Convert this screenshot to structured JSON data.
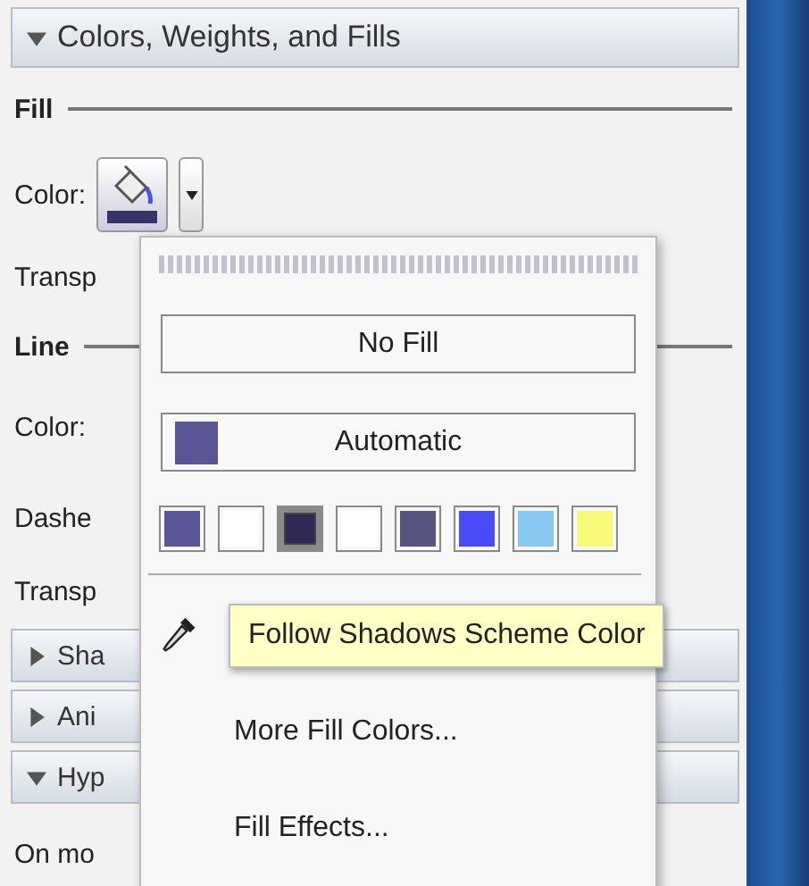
{
  "section_header": {
    "title": "Colors, Weights, and Fills",
    "expanded": true
  },
  "fill_group": {
    "title": "Fill",
    "color_label": "Color:",
    "transparency_label": "Transp"
  },
  "line_group": {
    "title": "Line",
    "color_label": "Color:",
    "dashed_label": "Dashe",
    "transparency_label": "Transp"
  },
  "collapsed_sections": [
    {
      "title": "Sha",
      "expanded": false
    },
    {
      "title": "Ani",
      "expanded": false
    },
    {
      "title": "Hyp",
      "expanded": true
    }
  ],
  "footer_label": "On mo",
  "fill_menu": {
    "no_fill": "No Fill",
    "automatic": "Automatic",
    "swatches": [
      {
        "color": "#5a5595",
        "selected": false
      },
      {
        "color": "#ffffff",
        "selected": false
      },
      {
        "color": "#2e2a55",
        "selected": true
      },
      {
        "color": "#ffffff",
        "selected": false
      },
      {
        "color": "#555580",
        "selected": false
      },
      {
        "color": "#4a4af8",
        "selected": false
      },
      {
        "color": "#88c8f0",
        "selected": false
      },
      {
        "color": "#f8f878",
        "selected": false
      }
    ],
    "items": [
      "More Fill Colors...",
      "Fill Effects..."
    ]
  },
  "tooltip": "Follow Shadows Scheme Color"
}
